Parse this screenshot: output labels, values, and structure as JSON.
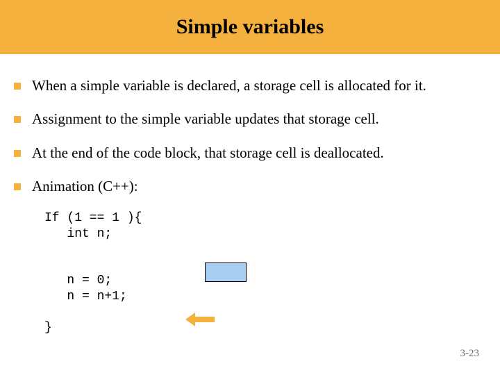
{
  "title": "Simple variables",
  "bullets": [
    "When a simple variable is declared, a storage cell is allocated for it.",
    "Assignment to the simple variable updates that storage cell.",
    "At the end of the code block, that storage cell is deallocated.",
    "Animation (C++):"
  ],
  "code": "If (1 == 1 ){\n   int n;\n\n\n   n = 0;\n   n = n+1;\n\n}",
  "slide_number": "3-23",
  "colors": {
    "accent": "#f5b13d",
    "cell_fill": "#a9cff0"
  }
}
